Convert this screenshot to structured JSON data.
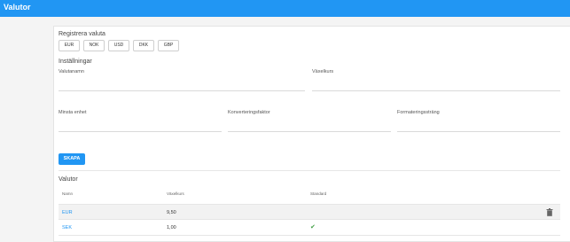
{
  "header": {
    "title": "Valutor"
  },
  "register": {
    "title": "Registrera valuta",
    "currencies": [
      "EUR",
      "NOK",
      "USD",
      "DKK",
      "GBP"
    ]
  },
  "settings": {
    "title": "Inställningar",
    "fields": {
      "currency_name": "Valutanamn",
      "exchange_rate": "Växelkurs",
      "min_unit": "Minsta enhet",
      "conversion_factor": "Konverteringsfaktor",
      "format_string": "Formateringssträng"
    },
    "create_label": "SKAPA"
  },
  "currencies_table": {
    "title": "Valutor",
    "columns": [
      "Namn",
      "Växelkurs",
      "Standard"
    ],
    "rows": [
      {
        "name": "EUR",
        "rate": "9,50",
        "standard": false,
        "row_bg": "#f2f2f2"
      },
      {
        "name": "SEK",
        "rate": "1,00",
        "standard": true,
        "row_bg": "#ffffff"
      }
    ]
  },
  "colors": {
    "accent": "#2196f3",
    "check": "#43a047"
  }
}
